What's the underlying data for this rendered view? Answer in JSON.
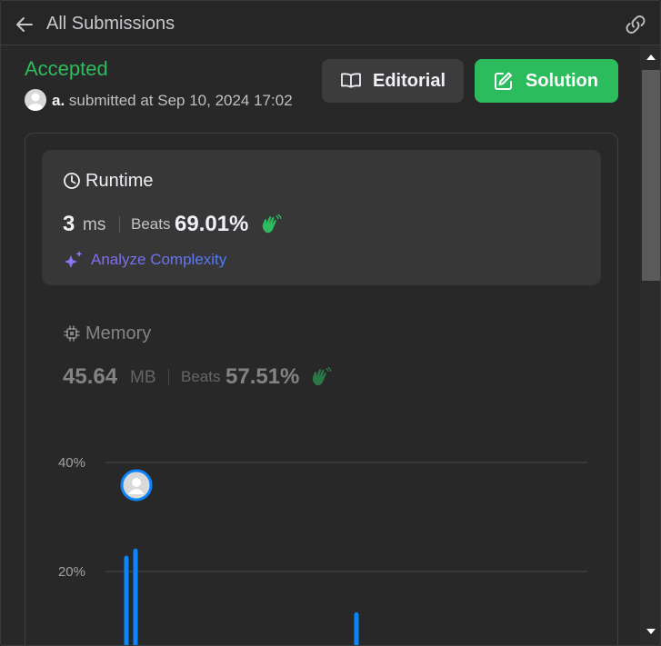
{
  "header": {
    "title": "All Submissions",
    "back_icon": "arrow-left-icon",
    "link_icon": "link-icon"
  },
  "submission": {
    "status": "Accepted",
    "username": "a.",
    "submitted_text": " submitted at Sep 10, 2024 17:02"
  },
  "buttons": {
    "editorial": "Editorial",
    "solution": "Solution"
  },
  "runtime": {
    "label": "Runtime",
    "value": "3",
    "unit": "ms",
    "beats_label": "Beats",
    "beats_value": "69.01%",
    "analyze_label": "Analyze Complexity"
  },
  "memory": {
    "label": "Memory",
    "value": "45.64",
    "unit": "MB",
    "beats_label": "Beats",
    "beats_value": "57.51%"
  },
  "colors": {
    "accent_green": "#2cbb5d",
    "bar_blue": "#0a84ff",
    "panel_bg": "#282828",
    "card_bg": "#373737"
  },
  "chart_data": {
    "type": "bar",
    "title": "",
    "xlabel": "",
    "ylabel": "",
    "y_ticks": [
      "40%",
      "20%"
    ],
    "ylim": [
      0,
      40
    ],
    "grid": true,
    "bars": [
      {
        "x_index": 0,
        "value": 22.9
      },
      {
        "x_index": 1,
        "value": 24.2
      },
      {
        "x_index": 2,
        "value": 12.5
      }
    ],
    "marker_on_bar_index": 1
  }
}
